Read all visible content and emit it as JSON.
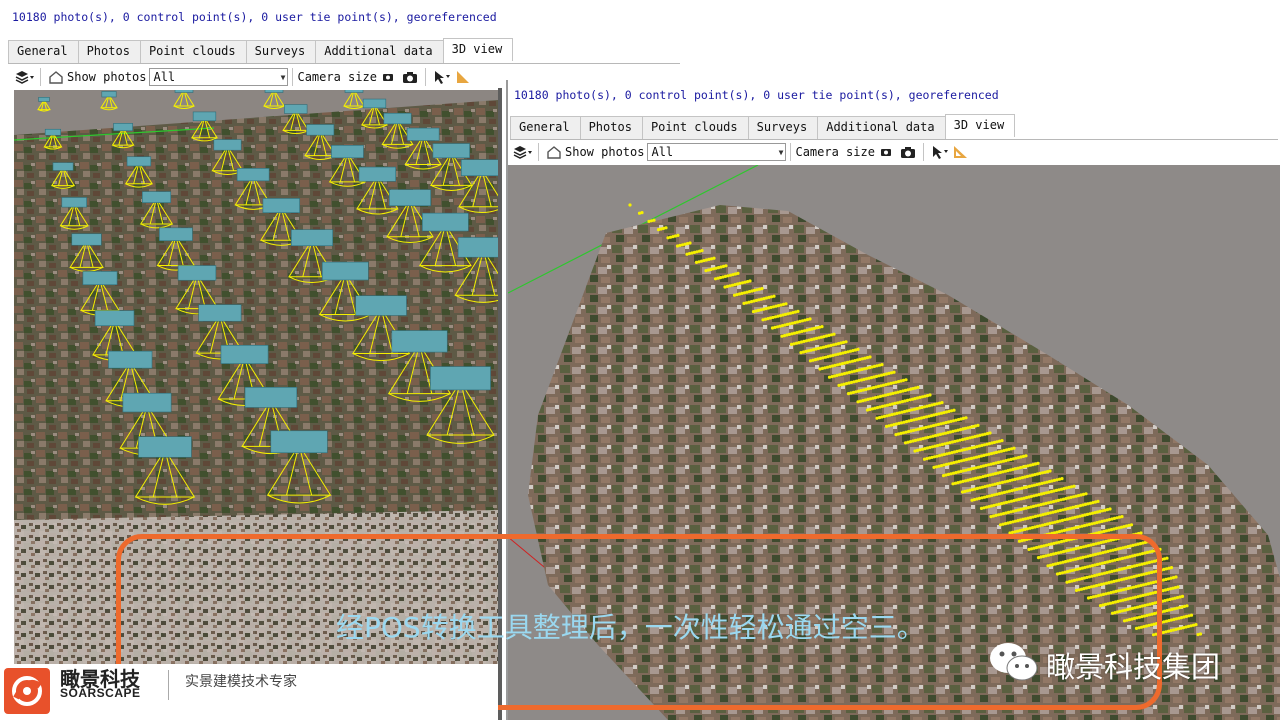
{
  "left_window": {
    "status": "10180 photo(s), 0 control point(s), 0 user tie point(s), georeferenced",
    "tabs": [
      "General",
      "Photos",
      "Point clouds",
      "Surveys",
      "Additional data",
      "3D view"
    ],
    "active_tab": "3D view",
    "toolbar": {
      "show_photos_label": "Show photos",
      "show_photos_value": "All",
      "camera_size_label": "Camera size"
    }
  },
  "right_window": {
    "status": "10180 photo(s), 0 control point(s), 0 user tie point(s), georeferenced",
    "tabs": [
      "General",
      "Photos",
      "Point clouds",
      "Surveys",
      "Additional data",
      "3D view"
    ],
    "active_tab": "3D view",
    "toolbar": {
      "show_photos_label": "Show photos",
      "show_photos_value": "All",
      "camera_size_label": "Camera size"
    }
  },
  "overlay": {
    "caption": "经POS转换工具整理后，一次性轻松通过空三。",
    "brand_cn": "瞰景科技",
    "brand_en": "SOARSCAPE",
    "tagline": "实景建模技术专家",
    "wechat_account": "瞰景科技集团"
  },
  "icons": [
    "layers-icon",
    "home-icon",
    "camera-small-icon",
    "camera-icon",
    "pointer-icon",
    "ruler-icon",
    "wechat-icon",
    "soarscape-logo"
  ],
  "colors": {
    "accent_orange": "#ee6a2d",
    "camera_yellow": "#f5f000",
    "status_blue": "#1a1aa0",
    "caption_blue": "#9ad8f0"
  }
}
